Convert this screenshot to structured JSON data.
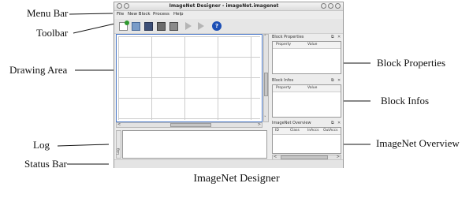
{
  "annotations": {
    "menu_bar": "Menu Bar",
    "toolbar": "Toolbar",
    "drawing_area": "Drawing Area",
    "log": "Log",
    "status_bar": "Status Bar",
    "block_properties": "Block Properties",
    "block_infos": "Block Infos",
    "imagenet_overview": "ImageNet Overview"
  },
  "caption": "ImageNet Designer",
  "window": {
    "title": "ImageNet Designer - imageNet.imagenet",
    "menu": [
      "File",
      "New Block",
      "Process",
      "Help"
    ],
    "toolbar_icons": [
      "new-file-icon",
      "open-icon",
      "save-icon",
      "edit-icon",
      "export-icon",
      "run-icon",
      "run-all-icon",
      "help-icon"
    ],
    "docks": {
      "block_properties": {
        "title": "Block Properties",
        "columns": [
          "Property",
          "Value"
        ]
      },
      "block_infos": {
        "title": "Block Infos",
        "columns": [
          "Property",
          "Value"
        ]
      },
      "imagenet_overview": {
        "title": "ImageNet Overview",
        "columns": [
          "ID",
          "Class",
          "InAccs",
          "OutAccs"
        ]
      }
    },
    "log_tab_label": "Log"
  },
  "colors": {
    "selection_border": "#4a78c8",
    "help_icon": "#1c4fb5",
    "new_icon": "#2f9a2f"
  }
}
